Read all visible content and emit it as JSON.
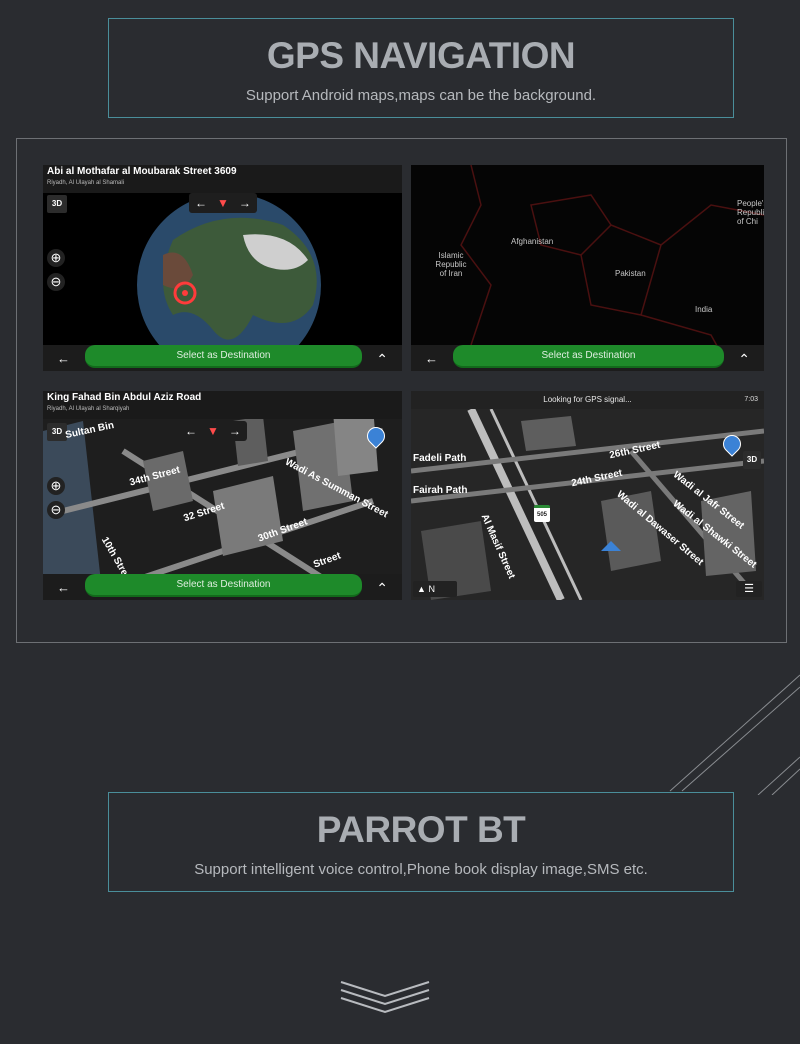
{
  "gps_section": {
    "title": "GPS NAVIGATION",
    "subtitle": "Support Android maps,maps can be the background."
  },
  "panels": {
    "globe": {
      "title": "Abi al Mothafar al Moubarak Street 3609",
      "subtitle": "Riyadh, Al Ulayah al Shamali",
      "mode": "3D",
      "destination_label": "Select as Destination"
    },
    "map": {
      "labels": [
        "Afghanistan",
        "Islamic Republic of Iran",
        "Pakistan",
        "India",
        "People's Republic of Chi"
      ],
      "destination_label": "Select as Destination"
    },
    "city3d": {
      "title": "King Fahad Bin Abdul Aziz Road",
      "subtitle": "Riyadh, Al Ulayah al Sharqiyah",
      "mode": "3D",
      "streets": [
        "Sultan Bin",
        "34th Street",
        "32 Street",
        "30th Street",
        "Wadi As Summan Street",
        "10th Stre",
        "Street"
      ],
      "destination_label": "Select as Destination"
    },
    "navigation": {
      "gps_status": "Looking for GPS signal...",
      "time": "7:03",
      "mode": "3D",
      "streets": [
        "Fadeli Path",
        "Fairah Path",
        "26th Street",
        "24th Street",
        "Al Masif Street",
        "Wadi al Dawaser Street",
        "Wadi al Jafr Street",
        "Wadi al Shawki Street"
      ],
      "shield": "505",
      "heading": "N"
    }
  },
  "bt_section": {
    "title": "PARROT BT",
    "subtitle": "Support intelligent voice control,Phone book display image,SMS etc."
  },
  "colors": {
    "background": "#2a2c30",
    "accent_border": "#4a8e9a",
    "destination_button": "#1e8a2a"
  }
}
